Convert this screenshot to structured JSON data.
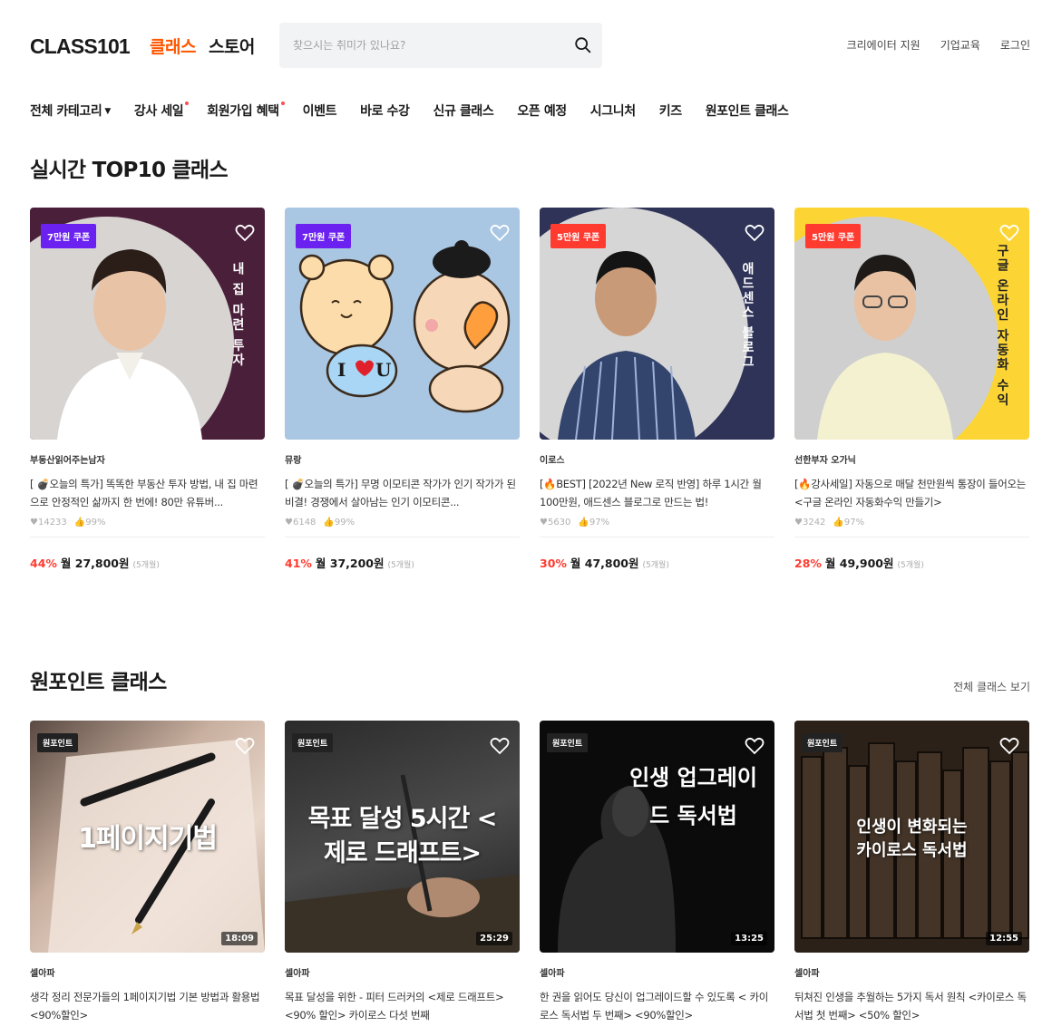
{
  "header": {
    "logo": "CLASS101",
    "nav": [
      "클래스",
      "스토어"
    ],
    "search_placeholder": "찾으시는 취미가 있나요?",
    "links": [
      "크리에이터 지원",
      "기업교육",
      "로그인"
    ]
  },
  "categories": {
    "all": "전체 카테고리",
    "items": [
      "강사 세일",
      "회원가입 혜택",
      "이벤트",
      "바로 수강",
      "신규 클래스",
      "오픈 예정",
      "시그니처",
      "키즈",
      "원포인트 클래스"
    ]
  },
  "sections": {
    "top10_title": "실시간 TOP10 클래스",
    "onepoint_title": "원포인트 클래스",
    "see_all": "전체 클래스 보기"
  },
  "top10": [
    {
      "badge": "7만원 쿠폰",
      "badge_color": "#6b21f0",
      "overlay": "내 집 마련 투자",
      "creator": "부동산읽어주는남자",
      "title": "[ 💣오늘의 특가] 똑똑한 부동산 투자 방법, 내 집 마련으로 안정적인 삶까지 한 번에! 80만 유튜버...",
      "likes": "14233",
      "rating": "99%",
      "discount": "44%",
      "price": "월 27,800원",
      "months": "(5개월)"
    },
    {
      "badge": "7만원 쿠폰",
      "badge_color": "#6b21f0",
      "overlay": "",
      "creator": "뮤랑",
      "title": "[ 💣오늘의 특가] 무명 이모티콘 작가가 인기 작가가 된 비결! 경쟁에서 살아남는 인기 이모티콘...",
      "likes": "6148",
      "rating": "99%",
      "discount": "41%",
      "price": "월 37,200원",
      "months": "(5개월)"
    },
    {
      "badge": "5만원 쿠폰",
      "badge_color": "#ff3b30",
      "overlay": "애드센스 블로그",
      "creator": "이로스",
      "title": "[🔥BEST] [2022년 New 로직 반영] 하루 1시간 월 100만원, 애드센스 블로그로 만드는 법!",
      "likes": "5630",
      "rating": "97%",
      "discount": "30%",
      "price": "월 47,800원",
      "months": "(5개월)"
    },
    {
      "badge": "5만원 쿠폰",
      "badge_color": "#ff3b30",
      "overlay": "구글 온라인 자동화 수익",
      "creator": "선한부자 오가닉",
      "title": "[🔥강사세일] 자동으로 매달 천만원씩 통장이 들어오는 <구글 온라인 자동화수익 만들기>",
      "likes": "3242",
      "rating": "97%",
      "discount": "28%",
      "price": "월 49,900원",
      "months": "(5개월)"
    }
  ],
  "onepoint": [
    {
      "badge": "원포인트",
      "overlay": "1페이지기법",
      "duration": "18:09",
      "creator": "셀아파",
      "title": "생각 정리 전문가들의 1페이지기법 기본 방법과 활용법 <90%할인>"
    },
    {
      "badge": "원포인트",
      "overlay": "목표 달성 5시간 <제로 드래프트>",
      "duration": "25:29",
      "creator": "셀아파",
      "title": "목표 달성을 위한 - 피터 드러커의 <제로 드래프트> <90% 할인> 카이로스 다섯 번째"
    },
    {
      "badge": "원포인트",
      "overlay": "인생 업그레이드 독서법",
      "duration": "13:25",
      "creator": "셀아파",
      "title": "한 권을 읽어도 당신이 업그레이드할 수 있도록 < 카이로스 독서법 두 번째> <90%할인>"
    },
    {
      "badge": "원포인트",
      "overlay": "인생이 변화되는 카이로스 독서법",
      "duration": "12:55",
      "creator": "셀아파",
      "title": "뒤쳐진 인생을 추월하는 5가지 독서 원칙 <카이로스 독서법 첫 번째> <50% 할인>"
    }
  ]
}
